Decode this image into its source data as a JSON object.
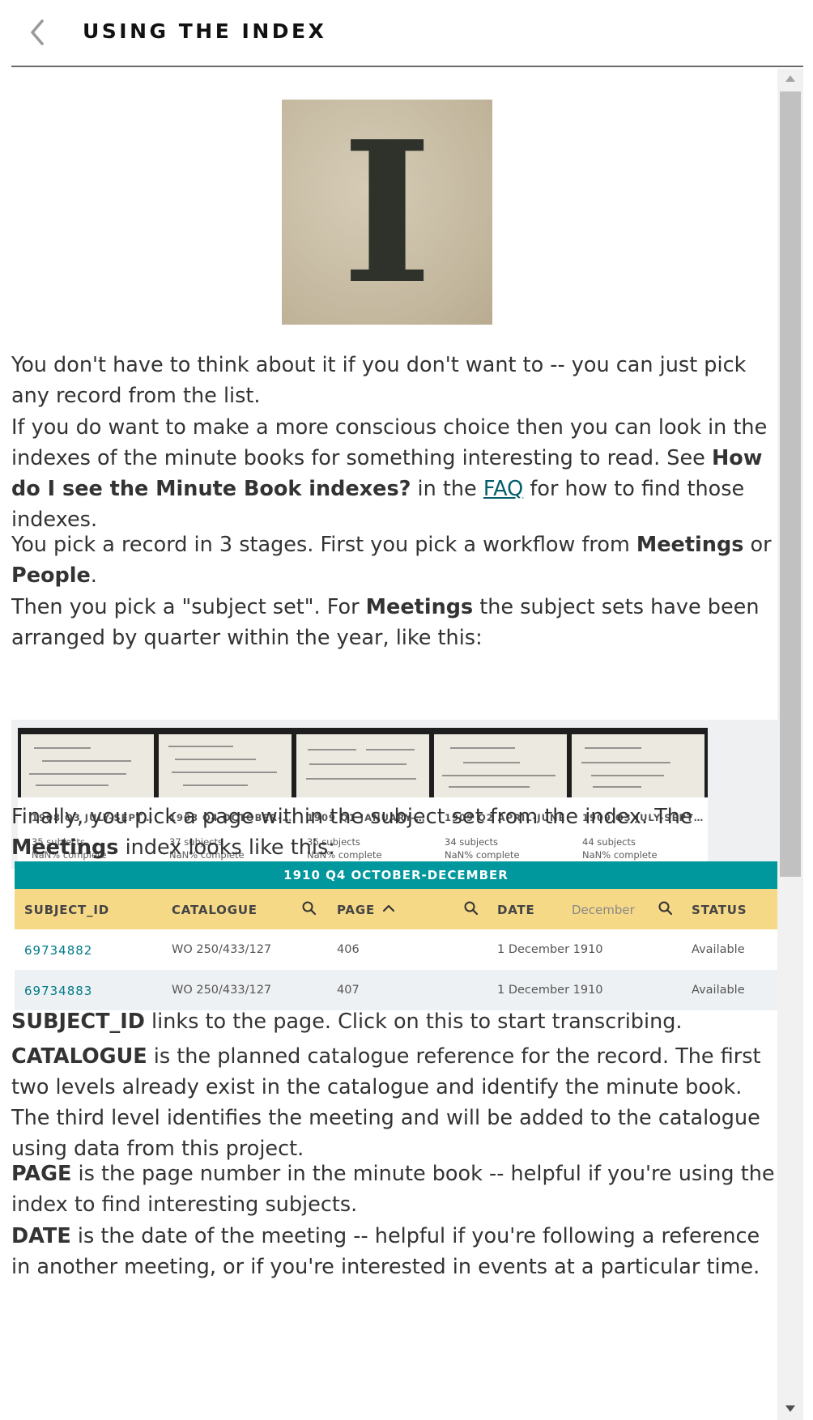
{
  "header": {
    "title": "USING THE INDEX"
  },
  "hero": {
    "letter": "I"
  },
  "paragraphs": {
    "p1": "You don't have to think about it if you don't want to -- you can just pick any record from the list.",
    "p2_a": "If you do want to make a more conscious choice then you can look in the indexes of the minute books for something interesting to read. See ",
    "p2_b": "How do I see the Minute Book indexes?",
    "p2_c": " in the ",
    "p2_link": "FAQ",
    "p2_d": " for how to find those indexes.",
    "p3_a": "You pick a record in 3 stages. First you pick a workflow from ",
    "p3_b": "Meetings",
    "p3_c": " or ",
    "p3_d": "People",
    "p3_e": ".",
    "p4_a": "Then you pick a \"subject set\". For ",
    "p4_b": "Meetings",
    "p4_c": " the subject sets have been arranged by quarter within the year, like this:",
    "p5_a": "Finally, you pick a page within the subject set from the index. The ",
    "p5_b": "Meetings",
    "p5_c": " index looks like this:",
    "p6_a": "SUBJECT_ID",
    "p6_b": " links to the page. Click on this to start transcribing.",
    "p7_a": "CATALOGUE",
    "p7_b": " is the planned catalogue reference for the record. The first two levels already exist in the catalogue and identify the minute book. The third level identifies the meeting and will be added to the catalogue using data from this project.",
    "p8_a": "PAGE",
    "p8_b": " is the page number in the minute book -- helpful if you're using the index to find interesting subjects.",
    "p9_a": "DATE",
    "p9_b": " is the date of the meeting -- helpful if you're following a reference in another meeting, or if you're interested in events at a particular time."
  },
  "cards": [
    {
      "title": "1908 Q3 JULY-SEPT…",
      "subjects": "35 subjects",
      "complete": "NaN% complete"
    },
    {
      "title": "1908 Q4 OCTOBER-…",
      "subjects": "37 subjects",
      "complete": "NaN% complete"
    },
    {
      "title": "1909 Q1 JANUARY-…",
      "subjects": "36 subjects",
      "complete": "NaN% complete"
    },
    {
      "title": "1909 Q2 APRIL-JUNE",
      "subjects": "34 subjects",
      "complete": "NaN% complete"
    },
    {
      "title": "1909 Q3 JULY-SEPT…",
      "subjects": "44 subjects",
      "complete": "NaN% complete"
    }
  ],
  "table": {
    "title": "1910 Q4 OCTOBER-DECEMBER",
    "headers": {
      "subject_id": "SUBJECT_ID",
      "catalogue": "CATALOGUE",
      "page": "PAGE",
      "date": "DATE",
      "date_filter": "December",
      "status": "STATUS"
    },
    "rows": [
      {
        "subject_id": "69734882",
        "catalogue": "WO 250/433/127",
        "page": "406",
        "date": "1 December 1910",
        "status": "Available"
      },
      {
        "subject_id": "69734883",
        "catalogue": "WO 250/433/127",
        "page": "407",
        "date": "1 December 1910",
        "status": "Available"
      }
    ]
  },
  "colors": {
    "teal": "#00979d",
    "header_yellow": "#f6d987",
    "link": "#005f6b"
  }
}
